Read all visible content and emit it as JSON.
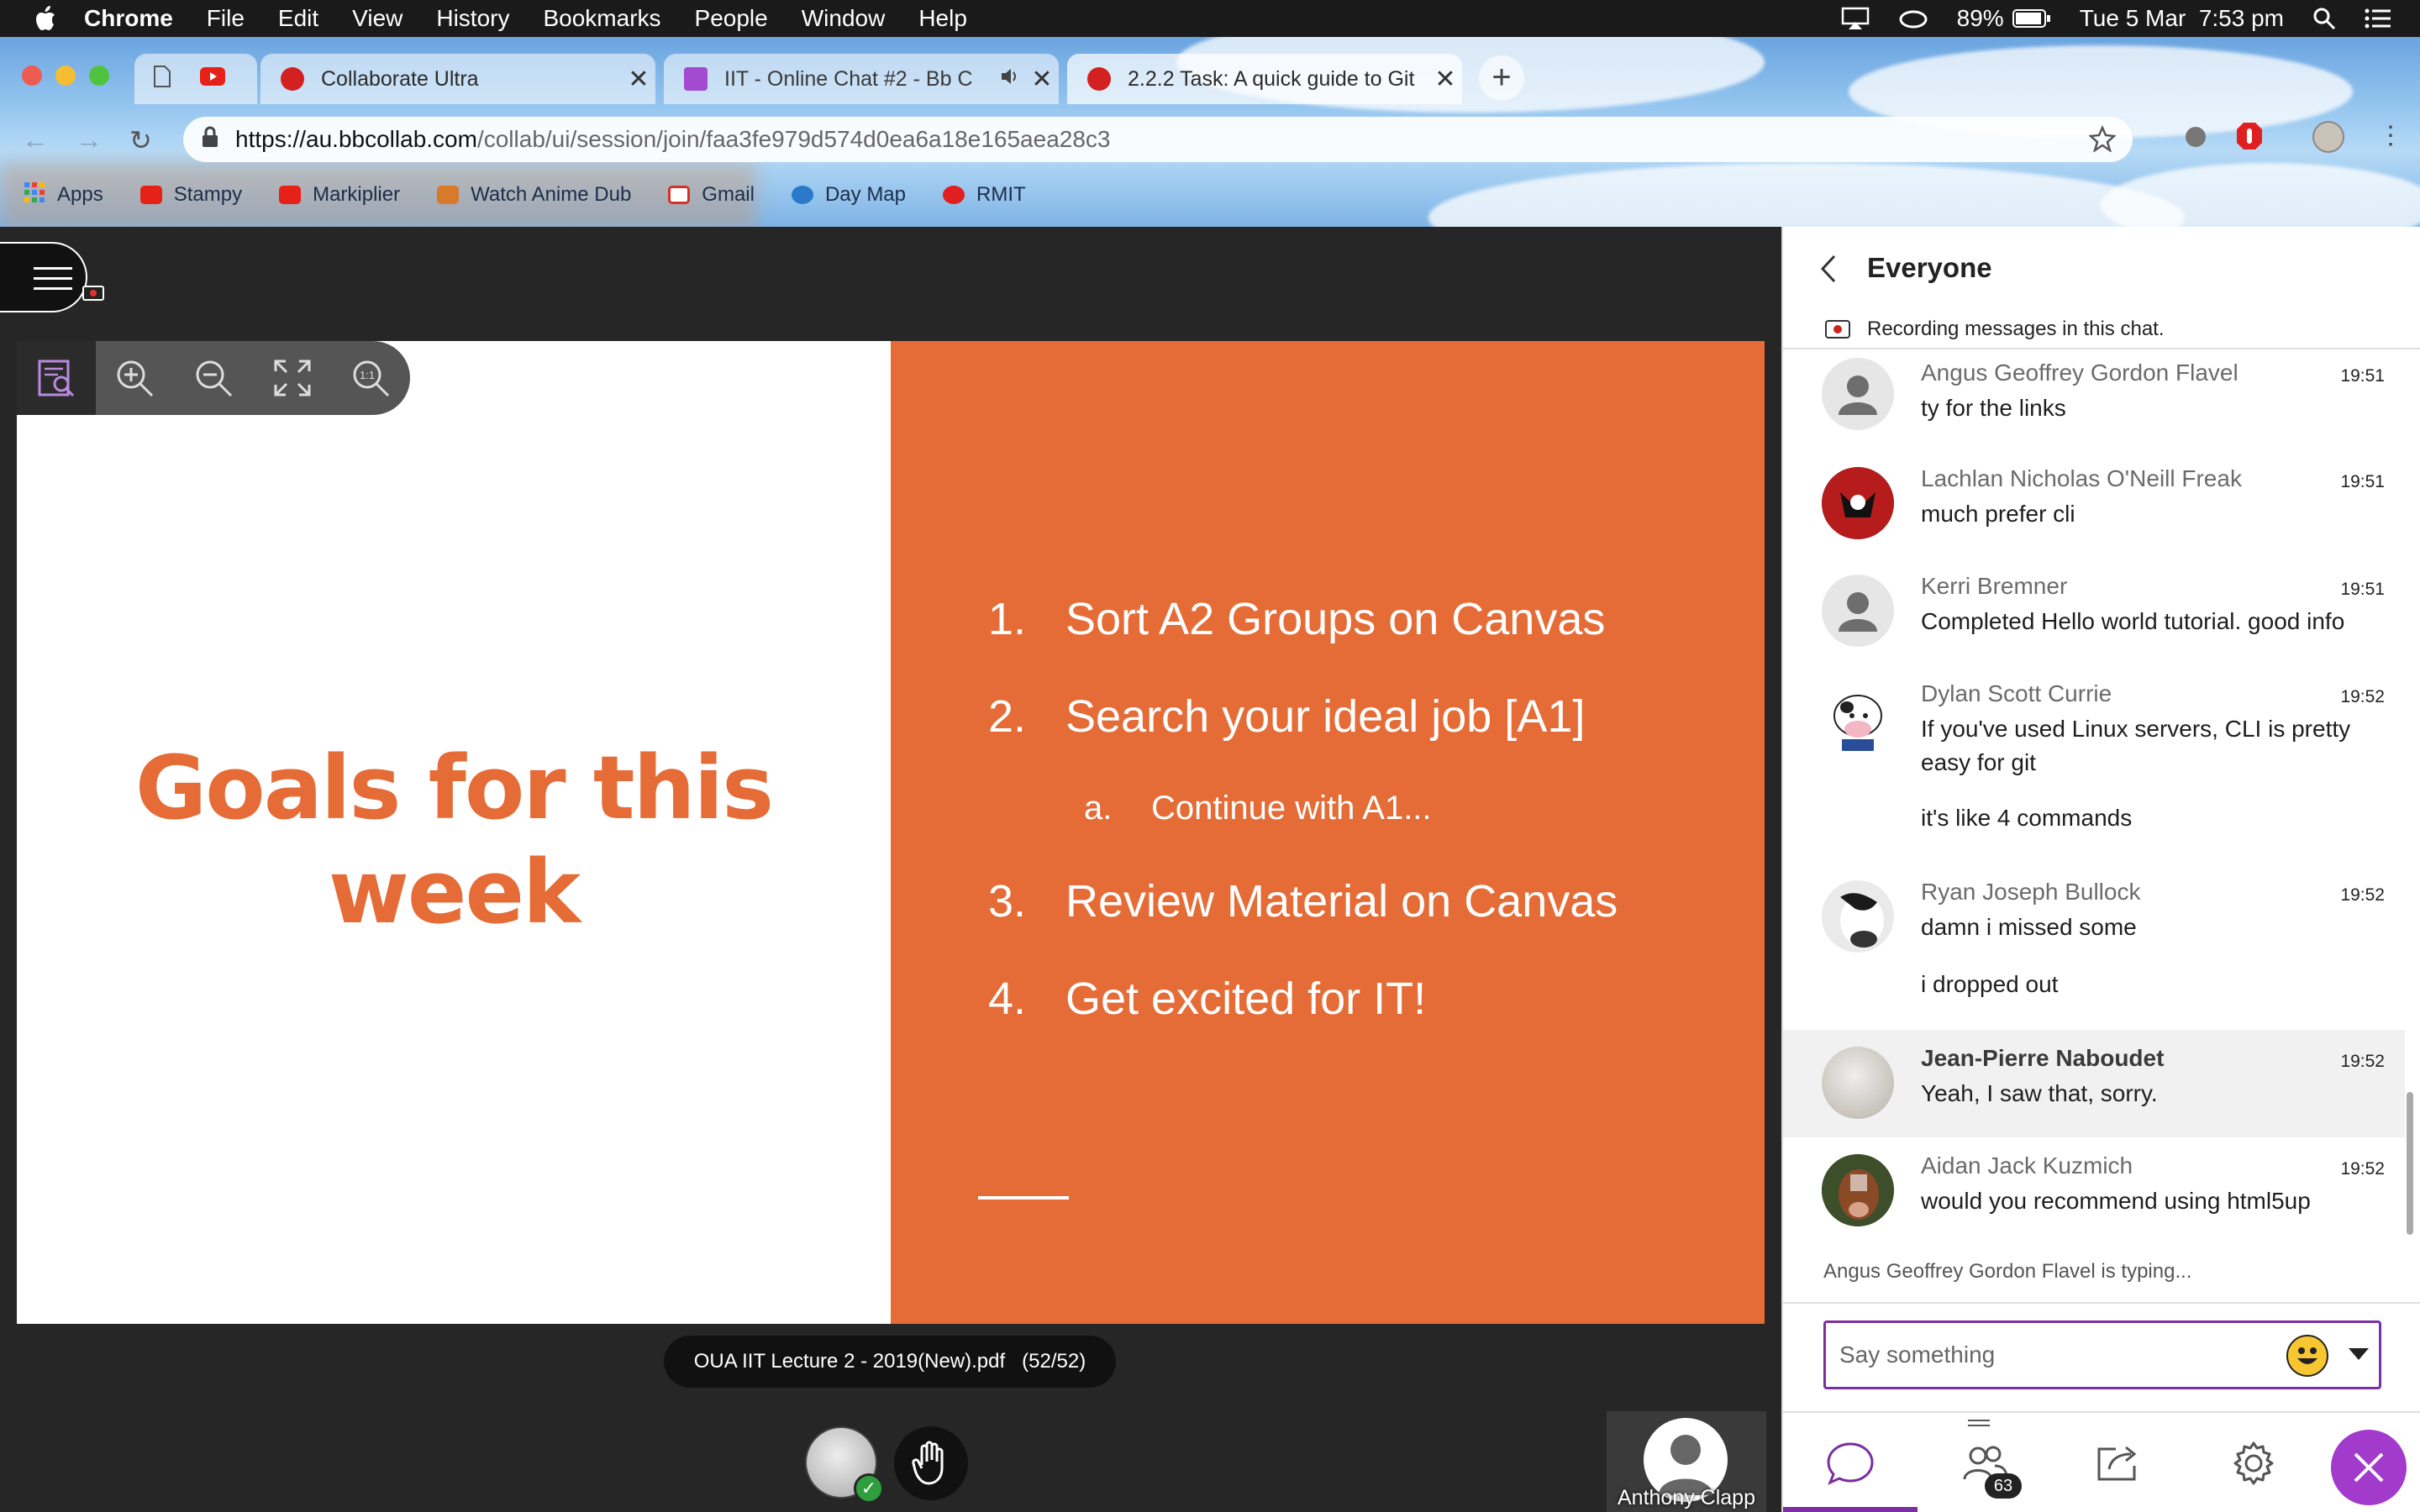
{
  "menubar": {
    "app": "Chrome",
    "items": [
      "File",
      "Edit",
      "View",
      "History",
      "Bookmarks",
      "People",
      "Window",
      "Help"
    ],
    "battery": "89%",
    "datetime": "Tue 5 Mar  7:53 pm"
  },
  "browser": {
    "tabs": [
      {
        "title": "Collaborate Ultra",
        "favicon": "bb-red-icon",
        "active": false
      },
      {
        "title": "IIT - Online Chat #2 - Bb C",
        "favicon": "bb-purple-icon",
        "audio": true,
        "active": false
      },
      {
        "title": "2.2.2 Task: A quick guide to Git",
        "favicon": "bb-red-icon",
        "active": true
      }
    ],
    "url_host": "https://au.bbcollab.com",
    "url_path": "/collab/ui/session/join/faa3fe979d574d0ea6a18e165aea28c3",
    "bookmarks": [
      {
        "label": "Apps",
        "icon": "apps-grid-icon",
        "color": "#4285f4"
      },
      {
        "label": "Stampy",
        "icon": "youtube-icon",
        "color": "#e62117"
      },
      {
        "label": "Markiplier",
        "icon": "youtube-icon",
        "color": "#e62117"
      },
      {
        "label": "Watch Anime Dub",
        "icon": "folder-icon",
        "color": "#d77a2a"
      },
      {
        "label": "Gmail",
        "icon": "gmail-icon",
        "color": "#d93025"
      },
      {
        "label": "Day Map",
        "icon": "daymap-icon",
        "color": "#2a7ac9"
      },
      {
        "label": "RMIT",
        "icon": "rmit-icon",
        "color": "#e02020"
      }
    ]
  },
  "slide": {
    "title": "Goals for this week",
    "goals": [
      {
        "num": "1.",
        "text": "Sort A2 Groups on Canvas"
      },
      {
        "num": "2.",
        "text": "Search your ideal job [A1]"
      },
      {
        "num": "a.",
        "text": "Continue with A1...",
        "sub": true
      },
      {
        "num": "3.",
        "text": "Review Material on Canvas"
      },
      {
        "num": "4.",
        "text": "Get excited for IT!"
      }
    ],
    "accent": "#e56c36"
  },
  "file": {
    "name": "OUA IIT Lecture 2 - 2019(New).pdf",
    "pages": "(52/52)"
  },
  "presenter": {
    "name": "Anthony Clapp"
  },
  "chat": {
    "title": "Everyone",
    "recording_notice": "Recording messages in this chat.",
    "messages": [
      {
        "name": "Angus Geoffrey Gordon Flavel",
        "time": "19:51",
        "lines": [
          "ty for the links"
        ],
        "avatar": "default"
      },
      {
        "name": "Lachlan Nicholas O'Neill Freak",
        "time": "19:51",
        "lines": [
          "much prefer cli"
        ],
        "avatar": "red"
      },
      {
        "name": "Kerri Bremner",
        "time": "19:51",
        "lines": [
          "Completed Hello world tutorial. good info"
        ],
        "avatar": "default"
      },
      {
        "name": "Dylan Scott Currie",
        "time": "19:52",
        "lines": [
          "If you've used Linux servers, CLI is pretty easy for git",
          "it's like 4 commands"
        ],
        "avatar": "cow"
      },
      {
        "name": "Ryan Joseph Bullock",
        "time": "19:52",
        "lines": [
          "damn i missed some",
          "i dropped out"
        ],
        "avatar": "cow2"
      },
      {
        "name": "Jean-Pierre Naboudet",
        "time": "19:52",
        "lines": [
          "Yeah, I saw that, sorry."
        ],
        "avatar": "sketch",
        "highlight": true
      },
      {
        "name": "Aidan Jack Kuzmich",
        "time": "19:52",
        "lines": [
          "would you recommend using html5up"
        ],
        "avatar": "calf"
      }
    ],
    "typing": "Angus Geoffrey Gordon Flavel is typing...",
    "input_placeholder": "Say something",
    "participants": "63",
    "accent": "#7b2fa2"
  }
}
